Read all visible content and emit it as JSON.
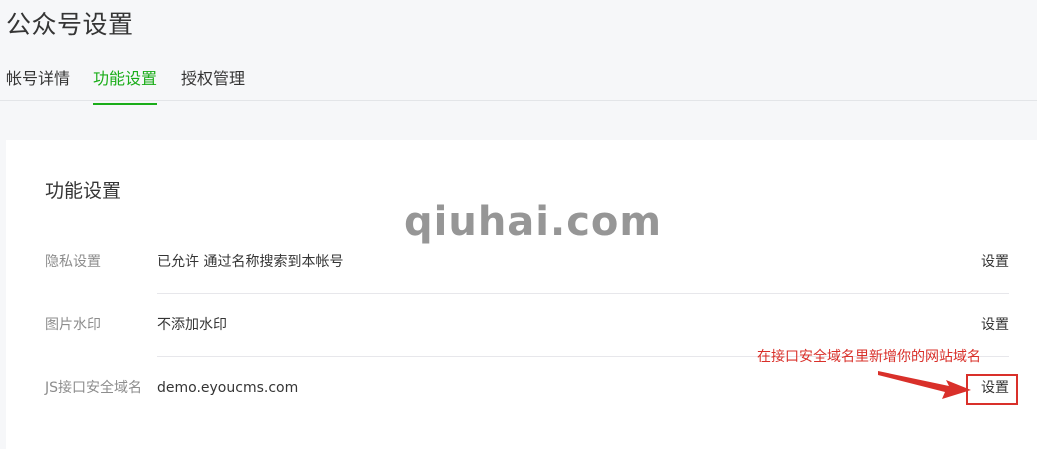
{
  "page": {
    "title": "公众号设置"
  },
  "tabs": [
    {
      "label": "帐号详情",
      "active": false
    },
    {
      "label": "功能设置",
      "active": true
    },
    {
      "label": "授权管理",
      "active": false
    }
  ],
  "section": {
    "title": "功能设置"
  },
  "watermark": {
    "text": "qiuhai.com"
  },
  "settings": [
    {
      "label": "隐私设置",
      "value": "已允许 通过名称搜索到本帐号",
      "action_label": "设置"
    },
    {
      "label": "图片水印",
      "value": "不添加水印",
      "action_label": "设置"
    },
    {
      "label": "JS接口安全域名",
      "value": "demo.eyoucms.com",
      "action_label": "设置"
    }
  ],
  "annotation": {
    "text": "在接口安全域名里新增你的网站域名",
    "color": "#d9302a"
  },
  "colors": {
    "accent": "#1aad19",
    "annotation": "#d9302a",
    "background": "#f6f7f9",
    "card": "#ffffff"
  }
}
